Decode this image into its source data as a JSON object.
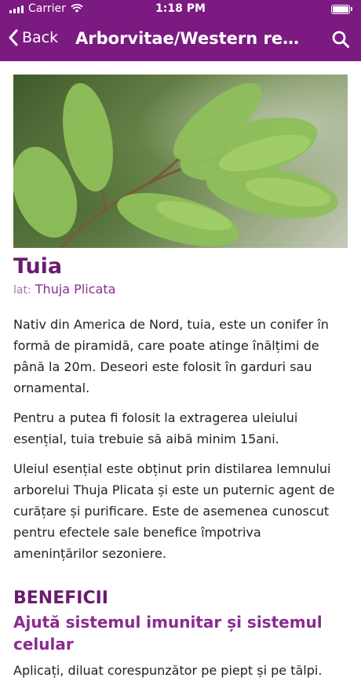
{
  "status_bar": {
    "carrier": "Carrier",
    "time": "1:18 PM"
  },
  "nav": {
    "back_label": "Back",
    "title": "Arborvitae/Western red..."
  },
  "hero_image": {
    "subject": "thuja branch close-up"
  },
  "plant": {
    "name": "Tuia",
    "latin_label": "lat:",
    "latin_name": "Thuja Plicata"
  },
  "description": [
    "Nativ din America de Nord, tuia, este un conifer în formă de piramidă, care poate atinge înălțimi de până la 20m. Deseori este folosit în garduri sau ornamental.",
    "Pentru a putea fi folosit la extragerea uleiului esențial, tuia trebuie să aibă minim 15ani.",
    "Uleiul esențial este obținut prin distilarea lemnului arborelui Thuja Plicata și este un puternic agent de curățare și purificare. Este de asemenea cunoscut pentru efectele sale benefice împotriva amenințărilor sezoniere."
  ],
  "benefits": {
    "title": "BENEFICII",
    "items": [
      {
        "title": "Ajută sistemul imunitar și sistemul celular",
        "text": "Aplicați, diluat corespunzător pe piept și pe tălpi."
      }
    ]
  },
  "colors": {
    "header_bg": "#7b1a80",
    "title_purple": "#6a1b6e",
    "accent_purple": "#8b2b90"
  }
}
